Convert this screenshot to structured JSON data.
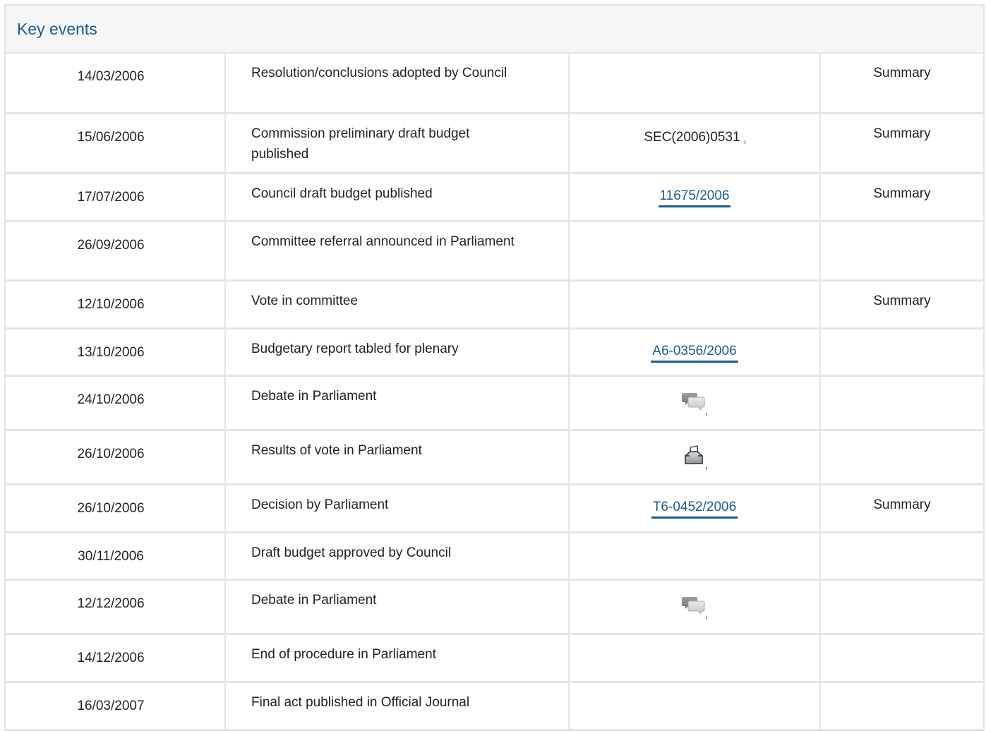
{
  "panel": {
    "title": "Key events"
  },
  "events": [
    {
      "date": "14/03/2006",
      "event": "Resolution/conclusions adopted by Council",
      "doc": "",
      "summary": "Summary",
      "height": 84
    },
    {
      "date": "15/06/2006",
      "event": "Commission preliminary draft budget published",
      "doc": "SEC(2006)0531",
      "summary": "Summary",
      "height": 85
    },
    {
      "date": "17/07/2006",
      "event": "Council draft budget published",
      "doc": "11675/2006",
      "summary": "Summary",
      "height": 68
    },
    {
      "date": "26/09/2006",
      "event": "Committee referral announced in Parliament",
      "doc": "",
      "summary": "",
      "height": 84
    },
    {
      "date": "12/10/2006",
      "event": "Vote in committee",
      "doc": "",
      "summary": "Summary",
      "height": 68
    },
    {
      "date": "13/10/2006",
      "event": "Budgetary report tabled for plenary",
      "doc": "A6-0356/2006",
      "summary": "",
      "height": 67
    },
    {
      "date": "24/10/2006",
      "event": "Debate in Parliament",
      "doc": "",
      "summary": "",
      "height": 77
    },
    {
      "date": "26/10/2006",
      "event": "Results of vote in Parliament",
      "doc": "",
      "summary": "",
      "height": 77
    },
    {
      "date": "26/10/2006",
      "event": "Decision by Parliament",
      "doc": "T6-0452/2006",
      "summary": "Summary",
      "height": 68
    },
    {
      "date": "30/11/2006",
      "event": "Draft budget approved by Council",
      "doc": "",
      "summary": "",
      "height": 67
    },
    {
      "date": "12/12/2006",
      "event": "Debate in Parliament",
      "doc": "",
      "summary": "",
      "height": 77
    },
    {
      "date": "14/12/2006",
      "event": "End of procedure in Parliament",
      "doc": "",
      "summary": "",
      "height": 68
    },
    {
      "date": "16/03/2007",
      "event": "Final act published in Official Journal",
      "doc": "",
      "summary": "",
      "height": 68
    }
  ],
  "icons": {
    "debate": "speech-bubbles-icon",
    "vote": "ballot-box-icon"
  },
  "colors": {
    "link": "#1a5c94",
    "border": "#e4e4e4",
    "header_bg": "#f5f6f6"
  }
}
